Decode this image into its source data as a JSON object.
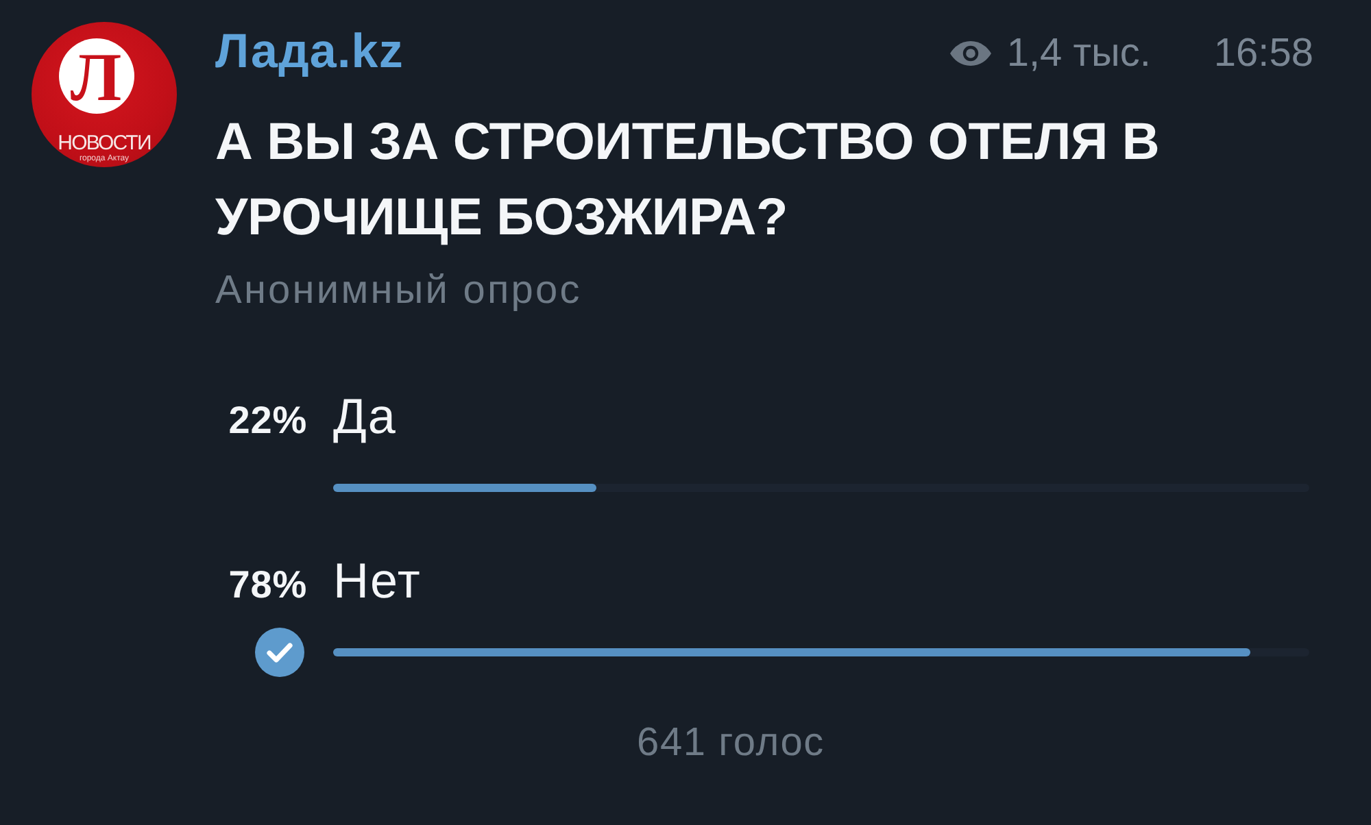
{
  "channel": {
    "avatar": {
      "letter": "Л",
      "caption": "НОВОСТИ",
      "subcaption": "города Актау"
    },
    "name": "Лада.kz",
    "views": "1,4 тыс.",
    "time": "16:58"
  },
  "poll": {
    "question": "А ВЫ ЗА СТРОИТЕЛЬСТВО ОТЕЛЯ В УРОЧИЩЕ БОЗЖИРА?",
    "type_label": "Анонимный опрос",
    "options": [
      {
        "percent": "22%",
        "label": "Да",
        "level": 0.27,
        "selected": false
      },
      {
        "percent": "78%",
        "label": "Нет",
        "level": 0.94,
        "selected": true
      }
    ],
    "total_votes": "641 голос"
  }
}
